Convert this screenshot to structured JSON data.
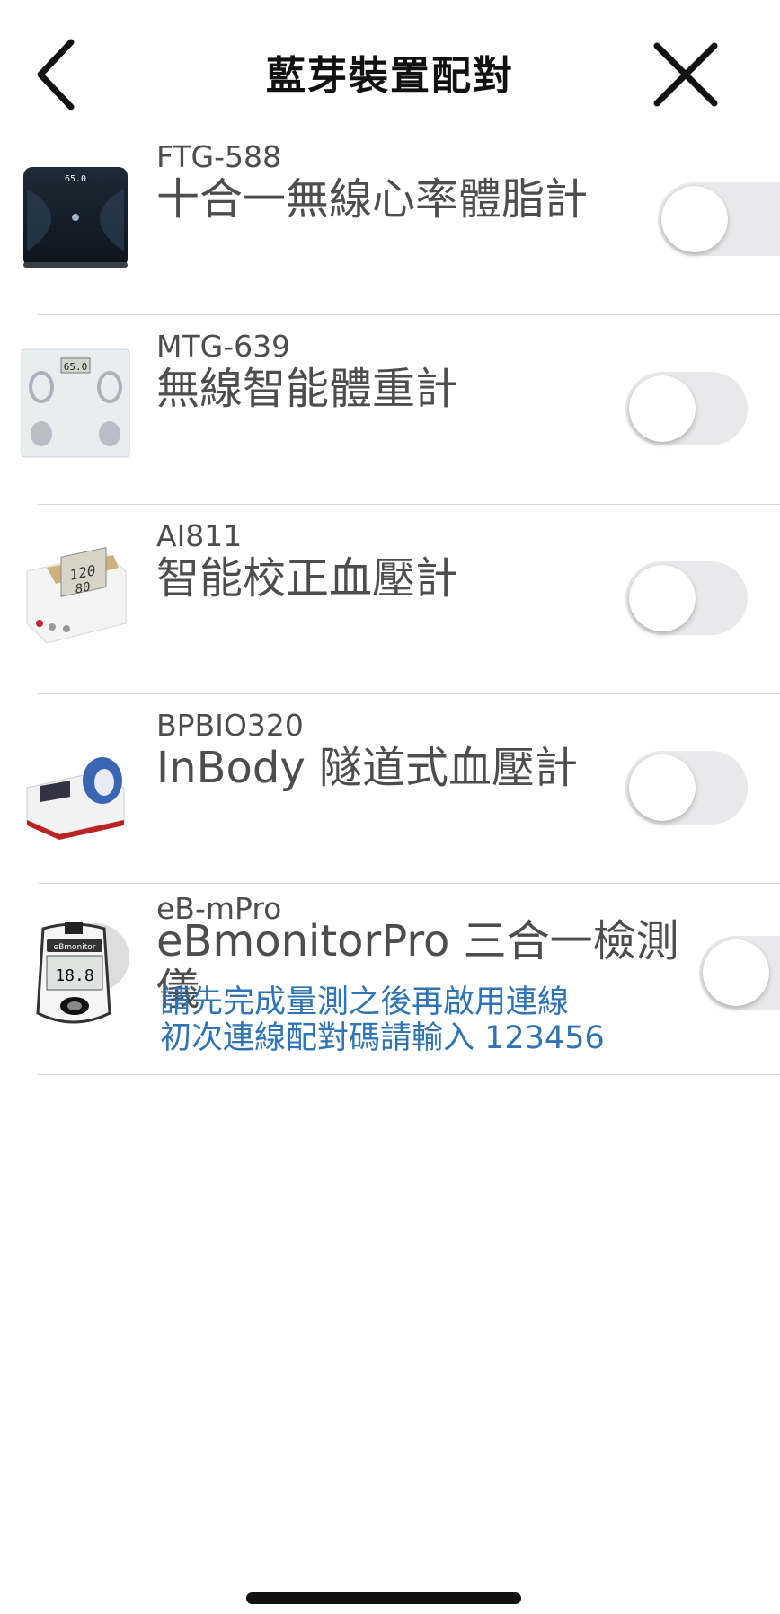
{
  "header": {
    "title": "藍芽裝置配對",
    "back_icon": "chevron-left-icon",
    "close_icon": "close-icon"
  },
  "devices": [
    {
      "model": "FTG-588",
      "name": "十合一無線心率體脂計",
      "enabled": false,
      "icon": "body-fat-scale-image"
    },
    {
      "model": "MTG-639",
      "name": "無線智能體重計",
      "enabled": false,
      "icon": "weight-scale-image"
    },
    {
      "model": "AI811",
      "name": "智能校正血壓計",
      "enabled": false,
      "icon": "blood-pressure-monitor-image"
    },
    {
      "model": "BPBIO320",
      "name": "InBody 隧道式血壓計",
      "enabled": false,
      "icon": "tunnel-bp-monitor-image"
    },
    {
      "model": "eB-mPro",
      "name_line1": "eBmonitorPro 三合一檢測",
      "name_line2": "儀",
      "enabled": false,
      "icon": "glucose-meter-image",
      "note_line1": "請先完成量測之後再啟用連線",
      "note_line2": "初次連線配對碼請輸入 123456"
    }
  ],
  "colors": {
    "note": "#2f74b5",
    "toggle_off": "#e9e9eb",
    "divider": "#d8d8d8"
  }
}
